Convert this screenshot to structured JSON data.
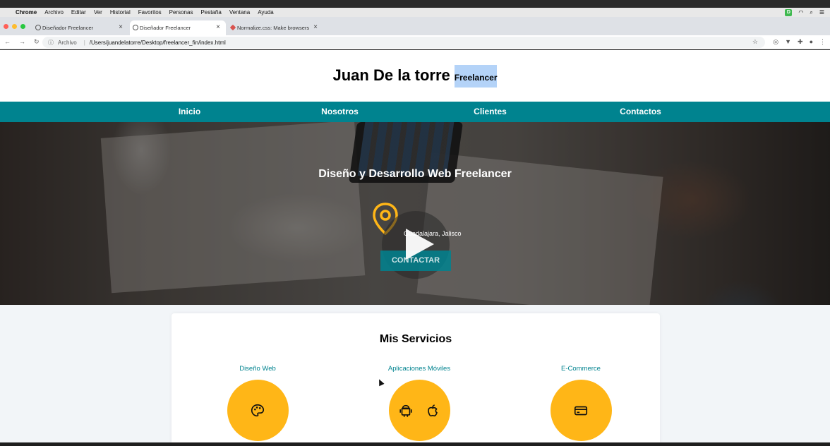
{
  "menubar": {
    "items": [
      "Chrome",
      "Archivo",
      "Editar",
      "Ver",
      "Historial",
      "Favoritos",
      "Personas",
      "Pestaña",
      "Ventana",
      "Ayuda"
    ],
    "status_icons": [
      "dashlane-icon",
      "wifi-icon",
      "spotlight-icon",
      "menu-icon"
    ]
  },
  "tabs": [
    {
      "title": "Diseñador Freelancer",
      "favicon": "globe-icon",
      "active": false
    },
    {
      "title": "Diseñador Freelancer",
      "favicon": "globe-icon",
      "active": true
    },
    {
      "title": "Normalize.css: Make browsers",
      "favicon": "normalize-icon",
      "active": false
    }
  ],
  "address": {
    "scheme_label": "Archivo",
    "path": "/Users/juandelatorre/Desktop/freelancer_fin/index.html"
  },
  "site": {
    "title": "Juan De la torre",
    "subtitle": "Freelancer",
    "nav": [
      "Inicio",
      "Nosotros",
      "Clientes",
      "Contactos"
    ],
    "hero": {
      "heading": "Diseño y Desarrollo Web Freelancer",
      "location": "Guadalajara, Jalisco",
      "button": "CONTACTAR"
    },
    "services": {
      "heading": "Mis Servicios",
      "items": [
        {
          "label": "Diseño Web",
          "icon": "palette-icon"
        },
        {
          "label": "Aplicaciones Móviles",
          "icon": "android-apple-icon"
        },
        {
          "label": "E-Commerce",
          "icon": "credit-card-icon"
        }
      ]
    }
  },
  "colors": {
    "nav_bg": "#00838f",
    "accent": "#ffb617",
    "selection": "#b4d3f8"
  }
}
